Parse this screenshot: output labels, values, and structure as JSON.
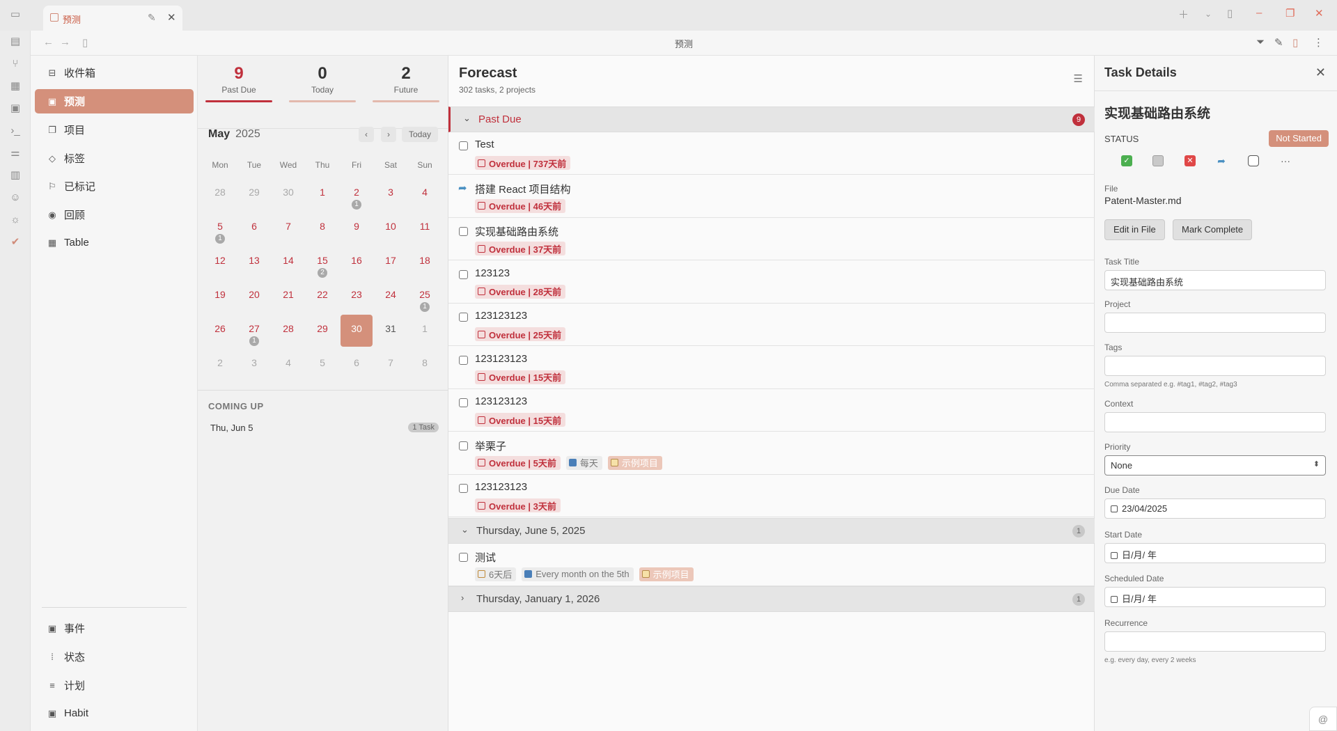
{
  "tab": {
    "title": "预测"
  },
  "navbar": {
    "title": "预测"
  },
  "sidebar": {
    "items": [
      {
        "label": "收件箱",
        "icon": "inbox-icon"
      },
      {
        "label": "预测",
        "icon": "calendar-icon"
      },
      {
        "label": "项目",
        "icon": "folder-icon"
      },
      {
        "label": "标签",
        "icon": "tag-icon"
      },
      {
        "label": "已标记",
        "icon": "flag-icon"
      },
      {
        "label": "回顾",
        "icon": "eye-icon"
      },
      {
        "label": "Table",
        "icon": "table-icon"
      }
    ],
    "bottom_items": [
      {
        "label": "事件",
        "icon": "calendar-icon"
      },
      {
        "label": "状态",
        "icon": "status-icon"
      },
      {
        "label": "计划",
        "icon": "chart-icon"
      },
      {
        "label": "Habit",
        "icon": "habit-icon"
      }
    ]
  },
  "stats": {
    "past_due": {
      "num": "9",
      "label": "Past Due"
    },
    "today": {
      "num": "0",
      "label": "Today"
    },
    "future": {
      "num": "2",
      "label": "Future"
    }
  },
  "calendar": {
    "month": "May",
    "year": "2025",
    "today_label": "Today",
    "weekdays": [
      "Mon",
      "Tue",
      "Wed",
      "Thu",
      "Fri",
      "Sat",
      "Sun"
    ],
    "weeks": [
      [
        {
          "d": "28",
          "t": "muted"
        },
        {
          "d": "29",
          "t": "muted"
        },
        {
          "d": "30",
          "t": "muted"
        },
        {
          "d": "1"
        },
        {
          "d": "2",
          "c": "1"
        },
        {
          "d": "3"
        },
        {
          "d": "4"
        }
      ],
      [
        {
          "d": "5",
          "c": "1"
        },
        {
          "d": "6"
        },
        {
          "d": "7"
        },
        {
          "d": "8"
        },
        {
          "d": "9"
        },
        {
          "d": "10"
        },
        {
          "d": "11"
        }
      ],
      [
        {
          "d": "12"
        },
        {
          "d": "13"
        },
        {
          "d": "14"
        },
        {
          "d": "15",
          "c": "2"
        },
        {
          "d": "16"
        },
        {
          "d": "17"
        },
        {
          "d": "18"
        }
      ],
      [
        {
          "d": "19"
        },
        {
          "d": "20"
        },
        {
          "d": "21"
        },
        {
          "d": "22"
        },
        {
          "d": "23"
        },
        {
          "d": "24"
        },
        {
          "d": "25",
          "c": "1"
        }
      ],
      [
        {
          "d": "26"
        },
        {
          "d": "27",
          "c": "1"
        },
        {
          "d": "28"
        },
        {
          "d": "29"
        },
        {
          "d": "30",
          "t": "sel"
        },
        {
          "d": "31",
          "t": "plain"
        },
        {
          "d": "1",
          "t": "muted"
        }
      ],
      [
        {
          "d": "2",
          "t": "muted"
        },
        {
          "d": "3",
          "t": "muted"
        },
        {
          "d": "4",
          "t": "muted"
        },
        {
          "d": "5",
          "t": "muted"
        },
        {
          "d": "6",
          "t": "muted"
        },
        {
          "d": "7",
          "t": "muted"
        },
        {
          "d": "8",
          "t": "muted"
        }
      ]
    ],
    "coming_up_title": "COMING UP",
    "coming_up": [
      {
        "date": "Thu, Jun 5",
        "badge": "1 Task"
      }
    ]
  },
  "forecast": {
    "title": "Forecast",
    "subtitle": "302 tasks, 2 projects",
    "sections": [
      {
        "title": "Past Due",
        "count": "9",
        "kind": "past",
        "expanded": true,
        "tasks": [
          {
            "title": "Test",
            "chips": [
              {
                "text": "Overdue | 737天前",
                "type": "overdue"
              }
            ]
          },
          {
            "title": "搭建 React 项目结构",
            "icon": "arrow",
            "chips": [
              {
                "text": "Overdue | 46天前",
                "type": "overdue"
              }
            ]
          },
          {
            "title": "实现基础路由系统",
            "chips": [
              {
                "text": "Overdue | 37天前",
                "type": "overdue"
              }
            ]
          },
          {
            "title": "123123",
            "chips": [
              {
                "text": "Overdue | 28天前",
                "type": "overdue"
              }
            ]
          },
          {
            "title": "123123123",
            "chips": [
              {
                "text": "Overdue | 25天前",
                "type": "overdue"
              }
            ]
          },
          {
            "title": "123123123",
            "chips": [
              {
                "text": "Overdue | 15天前",
                "type": "overdue"
              }
            ]
          },
          {
            "title": "123123123",
            "chips": [
              {
                "text": "Overdue | 15天前",
                "type": "overdue"
              }
            ]
          },
          {
            "title": "举栗子",
            "chips": [
              {
                "text": "Overdue | 5天前",
                "type": "overdue"
              },
              {
                "text": "每天",
                "type": "info",
                "icon": "rep"
              },
              {
                "text": "示例项目",
                "type": "proj",
                "icon": "fold"
              }
            ]
          },
          {
            "title": "123123123",
            "chips": [
              {
                "text": "Overdue | 3天前",
                "type": "overdue"
              }
            ]
          }
        ]
      },
      {
        "title": "Thursday, June 5, 2025",
        "count": "1",
        "kind": "normal",
        "expanded": true,
        "tasks": [
          {
            "title": "测试",
            "chips": [
              {
                "text": "6天后",
                "type": "info",
                "icon": "hour"
              },
              {
                "text": "Every month on the 5th",
                "type": "info",
                "icon": "rep"
              },
              {
                "text": "示例项目",
                "type": "proj",
                "icon": "fold"
              }
            ]
          }
        ]
      },
      {
        "title": "Thursday, January 1, 2026",
        "count": "1",
        "kind": "normal",
        "expanded": false,
        "tasks": []
      }
    ]
  },
  "details": {
    "title": "Task Details",
    "task_title": "实现基础路由系统",
    "status_label": "STATUS",
    "status_value": "Not Started",
    "file_label": "File",
    "file_value": "Patent-Master.md",
    "edit_button": "Edit in File",
    "complete_button": "Mark Complete",
    "task_title_label": "Task Title",
    "task_title_value": "实现基础路由系统",
    "project_label": "Project",
    "project_value": "",
    "tags_label": "Tags",
    "tags_value": "",
    "tags_help": "Comma separated e.g. #tag1, #tag2, #tag3",
    "context_label": "Context",
    "context_value": "",
    "priority_label": "Priority",
    "priority_value": "None",
    "due_label": "Due Date",
    "due_value": "23/04/2025",
    "start_label": "Start Date",
    "start_value": "日/月/ 年",
    "scheduled_label": "Scheduled Date",
    "scheduled_value": "日/月/ 年",
    "recurrence_label": "Recurrence",
    "recurrence_value": "",
    "recurrence_help": "e.g. every day, every 2 weeks"
  }
}
